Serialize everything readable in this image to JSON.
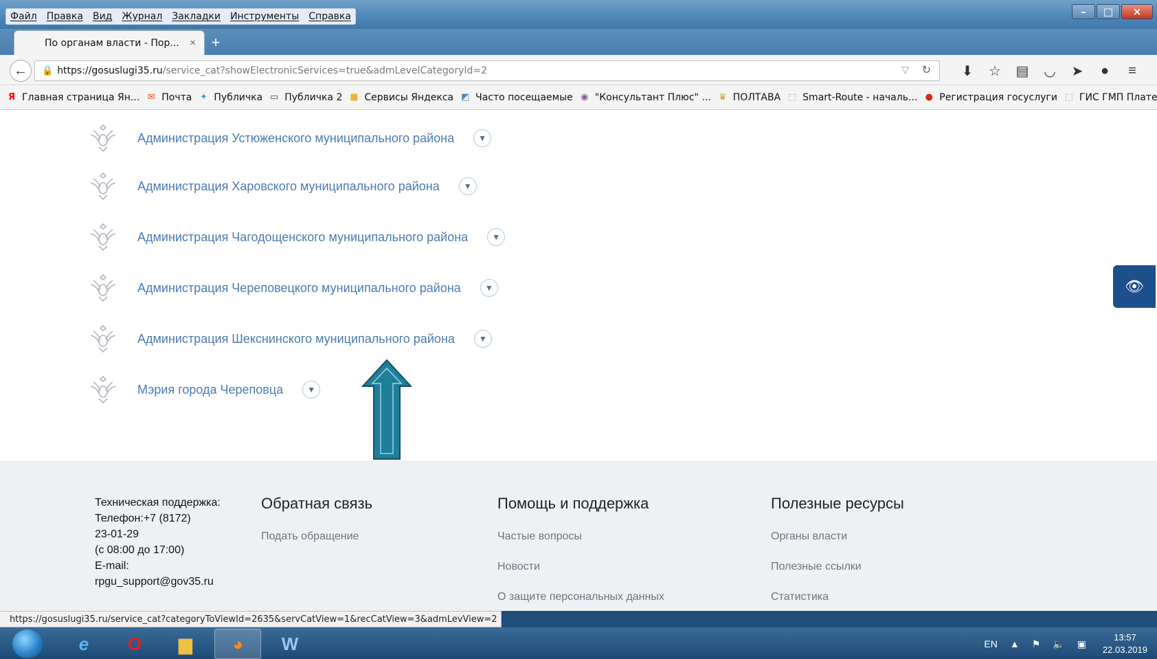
{
  "browser": {
    "menu": [
      "Файл",
      "Правка",
      "Вид",
      "Журнал",
      "Закладки",
      "Инструменты",
      "Справка"
    ],
    "tab_title": "По органам власти - Пор...",
    "tab_close": "×",
    "new_tab": "+",
    "url_host": "https://gosuslugi35.ru",
    "url_path": "/service_cat?showElectronicServices=true&admLevelCategoryId=2",
    "bookmarks": [
      {
        "label": "Главная страница Ян...",
        "icon": "yandex-icon"
      },
      {
        "label": "Почта",
        "icon": "mail-icon"
      },
      {
        "label": "Публичка",
        "icon": "map-pin-icon"
      },
      {
        "label": "Публичка 2",
        "icon": "page-icon"
      },
      {
        "label": "Сервисы Яндекса",
        "icon": "folder-icon"
      },
      {
        "label": "Часто посещаемые",
        "icon": "frequent-icon"
      },
      {
        "label": "\"Консультант Плюс\" ...",
        "icon": "consultant-icon"
      },
      {
        "label": "ПОЛТАВА",
        "icon": "poltava-icon"
      },
      {
        "label": "Smart-Route - началь...",
        "icon": "blank-page-icon"
      },
      {
        "label": "Регистрация госуслуги",
        "icon": "russia-flag-icon"
      },
      {
        "label": "ГИС ГМП Платежи",
        "icon": "blank-page-icon"
      }
    ]
  },
  "content": {
    "agencies": [
      "Администрация Устюженского муниципального района",
      "Администрация Харовского муниципального района",
      "Администрация Чагодощенского муниципального района",
      "Администрация Череповецкого муниципального района",
      "Администрация Шекснинского муниципального района",
      "Мэрия города Череповца"
    ]
  },
  "footer": {
    "support": {
      "lines": [
        "Техническая поддержка:",
        "Телефон:+7 (8172)",
        "23-01-29",
        "(с 08:00 до 17:00)",
        "E-mail:",
        "rpgu_support@gov35.ru"
      ]
    },
    "columns": [
      {
        "title": "Обратная связь",
        "links": [
          "Подать обращение"
        ]
      },
      {
        "title": "Помощь и поддержка",
        "links": [
          "Частые вопросы",
          "Новости",
          "О защите персональных данных"
        ]
      },
      {
        "title": "Полезные ресурсы",
        "links": [
          "Органы власти",
          "Полезные ссылки",
          "Статистика"
        ]
      }
    ]
  },
  "status_url": "https://gosuslugi35.ru/service_cat?categoryToViewId=2635&servCatView=1&recCatView=3&admLevView=2",
  "taskbar": {
    "lang": "EN",
    "time": "13:57",
    "date": "22.03.2019"
  },
  "colors": {
    "link": "#4a7bb3",
    "arrow": "#1f7f9a",
    "vision_button": "#1c4f8c"
  }
}
